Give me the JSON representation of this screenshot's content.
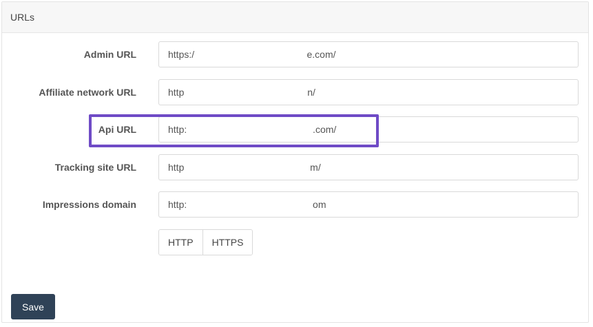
{
  "panel": {
    "title": "URLs"
  },
  "fields": [
    {
      "label": "Admin URL",
      "value": "https:/                                          e.com/"
    },
    {
      "label": "Affiliate network URL",
      "value": "http                                              n/"
    },
    {
      "label": "Api URL",
      "value": "http:                                               .com/"
    },
    {
      "label": "Tracking site URL",
      "value": "http                                               m/"
    },
    {
      "label": "Impressions domain",
      "value": "http:                                               om"
    }
  ],
  "protocol": {
    "options": [
      "HTTP",
      "HTTPS"
    ]
  },
  "actions": {
    "save_label": "Save"
  },
  "colors": {
    "highlight": "#6f4bc6",
    "save_button": "#2f4257"
  }
}
